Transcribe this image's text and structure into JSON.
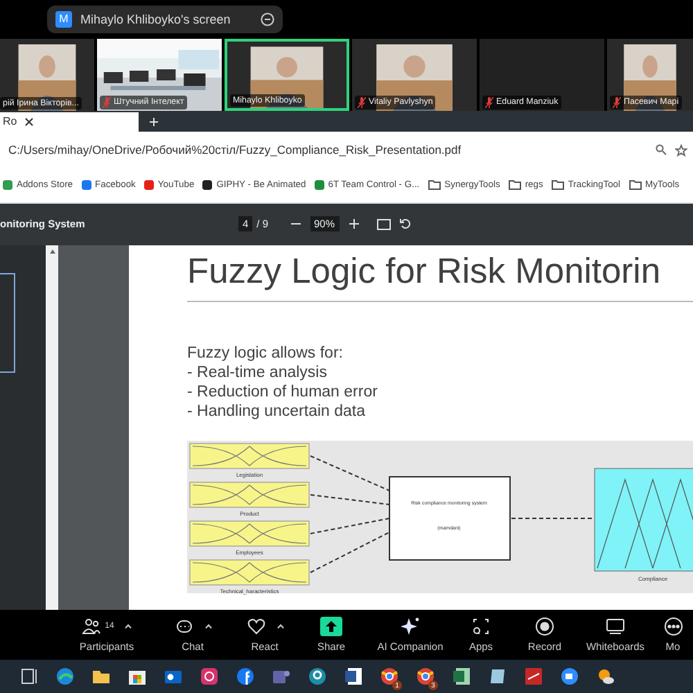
{
  "meeting_bar": {
    "badge": "M",
    "title": "Mihaylo Khliboyko's screen"
  },
  "participants": [
    {
      "name": "рій Ірина Вікторів...",
      "kind": "person",
      "muted": false,
      "active": false
    },
    {
      "name": "Штучний Інтелект",
      "kind": "room",
      "muted": true,
      "active": false
    },
    {
      "name": "Mihaylo Khliboyko",
      "kind": "person",
      "muted": false,
      "active": true
    },
    {
      "name": "Vitaliy Pavlyshyn",
      "kind": "person",
      "muted": true,
      "active": false
    },
    {
      "name": "Eduard Manziuk",
      "kind": "off",
      "muted": true,
      "active": false
    },
    {
      "name": "Пасевич Марі",
      "kind": "person",
      "muted": true,
      "active": false
    }
  ],
  "browser": {
    "tab": "Ro",
    "address": "C:/Users/mihay/OneDrive/Робочий%20стіл/Fuzzy_Compliance_Risk_Presentation.pdf",
    "bookmarks": [
      {
        "label": "Addons Store",
        "kind": "site",
        "color": "#2e9e4f"
      },
      {
        "label": "Facebook",
        "kind": "site",
        "color": "#1877f2"
      },
      {
        "label": "YouTube",
        "kind": "site",
        "color": "#e62117"
      },
      {
        "label": "GIPHY - Be Animated",
        "kind": "site",
        "color": "#222222"
      },
      {
        "label": "6T Team Control - G...",
        "kind": "site",
        "color": "#1e8e3e"
      },
      {
        "label": "SynergyTools",
        "kind": "folder"
      },
      {
        "label": "regs",
        "kind": "folder"
      },
      {
        "label": "TrackingTool",
        "kind": "folder"
      },
      {
        "label": "MyTools",
        "kind": "folder"
      }
    ]
  },
  "pdf": {
    "title": "onitoring System",
    "page": "4",
    "total": "/ 9",
    "zoom": "90%",
    "slide": {
      "title": "Fuzzy Logic for Risk Monitorin",
      "intro": "Fuzzy logic allows for:",
      "bullets": [
        "- Real-time analysis",
        "- Reduction of human error",
        "- Handling uncertain data"
      ],
      "diagram": {
        "inputs": [
          "Legislation",
          "Product",
          "Employees",
          "Technical_haracteristics"
        ],
        "system": "Risk compliance monitoring system",
        "method": "(mamdani)",
        "output": "Compliance"
      }
    }
  },
  "toolbar": [
    {
      "label": "Participants",
      "kind": "people",
      "count": "14",
      "caret": true
    },
    {
      "label": "Chat",
      "kind": "chat",
      "caret": true
    },
    {
      "label": "React",
      "kind": "heart",
      "caret": true
    },
    {
      "label": "Share",
      "kind": "share"
    },
    {
      "label": "AI Companion",
      "kind": "sparkle"
    },
    {
      "label": "Apps",
      "kind": "apps"
    },
    {
      "label": "Record",
      "kind": "record"
    },
    {
      "label": "Whiteboards",
      "kind": "board"
    },
    {
      "label": "Mo",
      "kind": "more"
    }
  ],
  "taskbar": [
    {
      "kind": "taskview"
    },
    {
      "kind": "browser"
    },
    {
      "kind": "folder"
    },
    {
      "kind": "store"
    },
    {
      "kind": "mail"
    },
    {
      "kind": "camera"
    },
    {
      "kind": "social"
    },
    {
      "kind": "team"
    },
    {
      "kind": "ring"
    },
    {
      "kind": "doc"
    },
    {
      "kind": "globe",
      "badge": "1"
    },
    {
      "kind": "globe",
      "badge": "3"
    },
    {
      "kind": "sheet"
    },
    {
      "kind": "tile"
    },
    {
      "kind": "pdf"
    },
    {
      "kind": "video"
    },
    {
      "kind": "weather"
    }
  ]
}
